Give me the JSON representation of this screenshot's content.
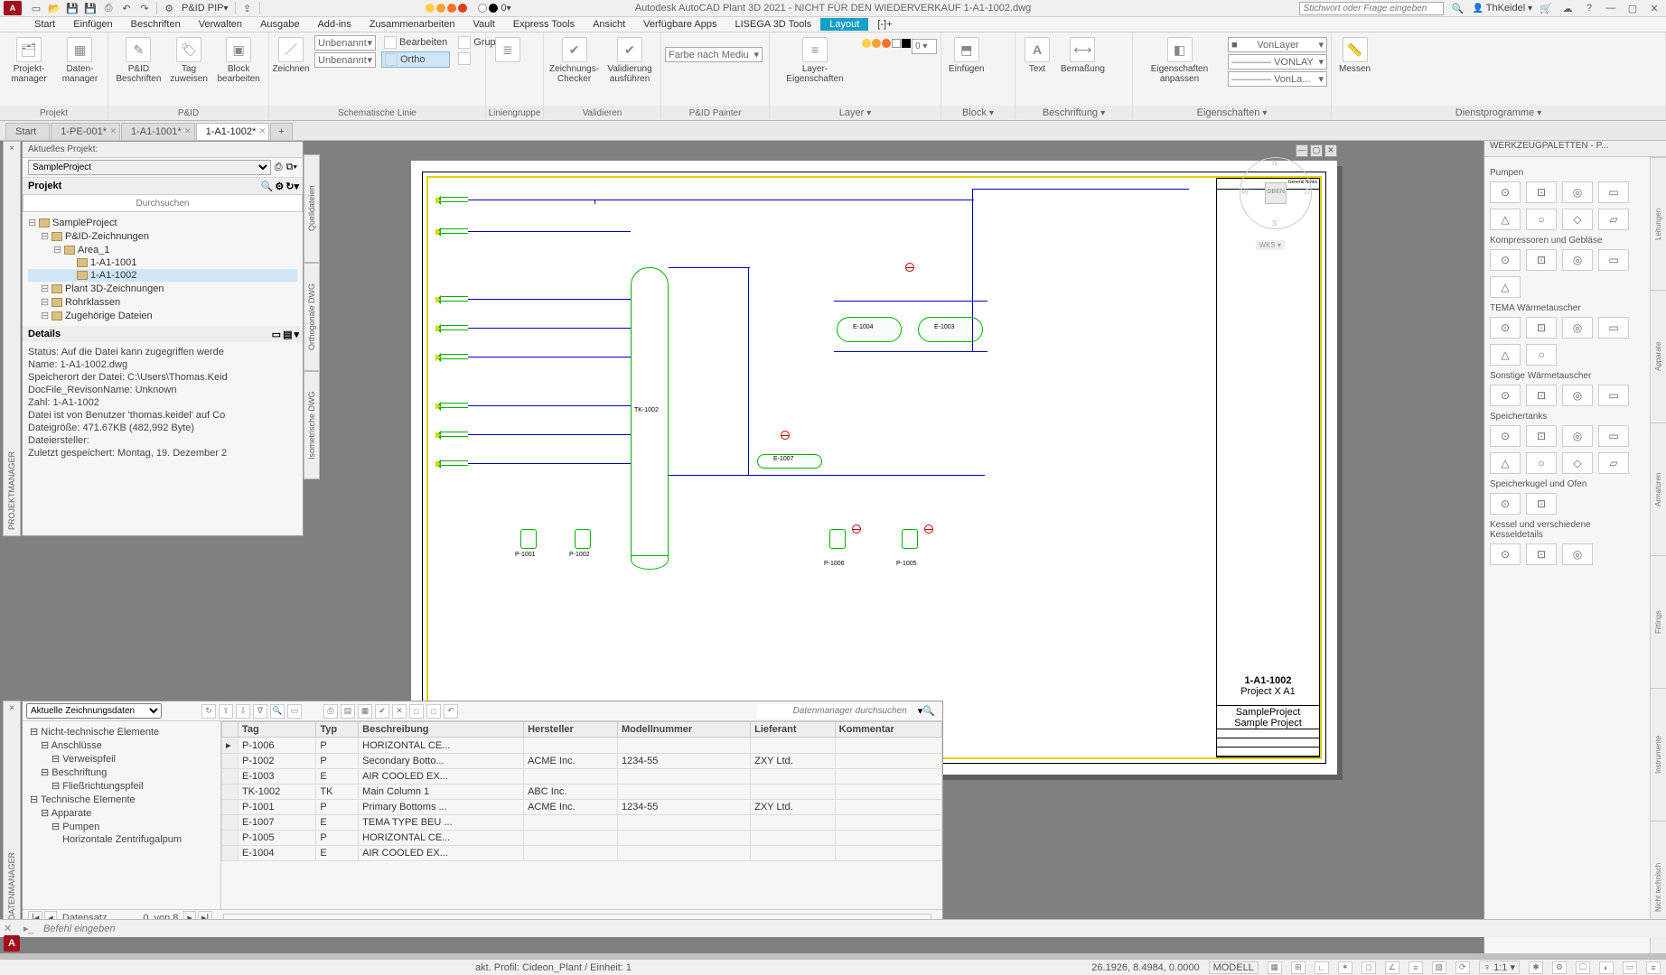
{
  "title": "Autodesk AutoCAD Plant 3D 2021 - NICHT FÜR DEN WIEDERVERKAUF    1-A1-1002.dwg",
  "workspace": "P&ID PIP",
  "gradientValue": "0",
  "searchPlaceholder": "Stichwort oder Frage eingeben",
  "user": "ThKeidel",
  "menus": [
    "Start",
    "Einfügen",
    "Beschriften",
    "Verwalten",
    "Ausgabe",
    "Add-ins",
    "Zusammenarbeiten",
    "Vault",
    "Express Tools",
    "Ansicht",
    "Verfügbare Apps",
    "LISEGA 3D Tools",
    "Layout",
    "[-]+"
  ],
  "activeMenu": "Layout",
  "ribbon": {
    "panels": [
      {
        "name": "Projekt",
        "items": [
          {
            "label": "Projekt-\nmanager"
          },
          {
            "label": "Daten-\nmanager"
          }
        ]
      },
      {
        "name": "P&ID",
        "items": [
          {
            "label": "P&ID\nBeschriften"
          },
          {
            "label": "Tag\nzuweisen"
          },
          {
            "label": "Block\nbearbeiten"
          }
        ]
      },
      {
        "name": "Schematische Linie",
        "combo1": "Unbenannt",
        "combo2": "Unbenannt",
        "miniEdit": "Bearbeiten",
        "miniGroup": "Gruppe",
        "miniOrtho": "Ortho",
        "drawBtn": "Zeichnen"
      },
      {
        "name": "Liniengruppe"
      },
      {
        "name": "Validieren",
        "items": [
          {
            "label": "Zeichnungs-\nChecker"
          },
          {
            "label": "Validierung\nausführen"
          }
        ]
      },
      {
        "name": "P&ID Painter",
        "combo": "Farbe nach Mediu"
      },
      {
        "name": "Layer",
        "label": "Layer-\nEigenschaften"
      },
      {
        "name": "Block",
        "label": "Einfügen"
      },
      {
        "name": "Beschriftung",
        "items": [
          {
            "label": "Text"
          },
          {
            "label": "Bemaßung"
          }
        ]
      },
      {
        "name": "Eigenschaften",
        "label": "Eigenschaften\nanpassen",
        "layerCombo": "VonLayer",
        "lt": "———— VONLAY",
        "lw": "———— VonLa..."
      },
      {
        "name": "Dienstprogramme",
        "label": "Messen"
      }
    ]
  },
  "docTabs": [
    {
      "label": "Start",
      "active": false,
      "closable": false
    },
    {
      "label": "1-PE-001*",
      "active": false,
      "closable": true
    },
    {
      "label": "1-A1-1001*",
      "active": false,
      "closable": true
    },
    {
      "label": "1-A1-1002*",
      "active": true,
      "closable": true
    }
  ],
  "projman": {
    "headLabel": "Aktuelles Projekt:",
    "project": "SampleProject",
    "sectionProjekt": "Projekt",
    "searchPlaceholder": "Durchsuchen",
    "tree": [
      {
        "l": "SampleProject",
        "d": 0
      },
      {
        "l": "P&ID-Zeichnungen",
        "d": 1
      },
      {
        "l": "Area_1",
        "d": 2
      },
      {
        "l": "1-A1-1001",
        "d": 3,
        "leaf": true
      },
      {
        "l": "1-A1-1002",
        "d": 3,
        "leaf": true,
        "sel": true
      },
      {
        "l": "Plant 3D-Zeichnungen",
        "d": 1
      },
      {
        "l": "Rohrklassen",
        "d": 1
      },
      {
        "l": "Zugehörige Dateien",
        "d": 1
      }
    ],
    "sectionDetails": "Details",
    "details": [
      "Status: Auf die Datei kann zugegriffen werde",
      "Name: 1-A1-1002.dwg",
      "Speicherort der Datei: C:\\Users\\Thomas.Keid",
      "DocFile_RevisonName:  Unknown",
      "Zahl: 1-A1-1002",
      "Datei ist von Benutzer 'thomas.keidel' auf Co",
      "Dateigröße: 471.67KB (482,992 Byte)",
      "Dateiersteller:",
      "Zuletzt gespeichert: Montag, 19. Dezember 2"
    ],
    "vstripLabel": "PROJEKTMANAGER"
  },
  "sideTabs": [
    "Quelldateien",
    "Orthogonale DWG",
    "Isometrische DWG"
  ],
  "viewcube": {
    "face": "OBEN",
    "n": "N",
    "s": "S",
    "w": "W",
    "o": "O",
    "wks": "WKS ▾"
  },
  "titleblock": {
    "dwgno": "1-A1-1002",
    "project": "Project   X   A1",
    "sample": "SampleProject\nSample Project"
  },
  "equipment": {
    "tank": "TK-1002",
    "ex1": "E-1004",
    "ex2": "E-1003",
    "ex3": "E-1007",
    "p1": "P-1001",
    "p2": "P-1002",
    "p3": "P-1005",
    "p4": "P-1006"
  },
  "palettes": {
    "title": "WERKZEUGPALETTEN - P...",
    "vtabs": [
      "Leitungen",
      "Apparate",
      "Armaturen",
      "Fittings",
      "Instrumente",
      "Nicht technisch"
    ],
    "groups": [
      {
        "title": "Pumpen",
        "count": 8
      },
      {
        "title": "Kompressoren und Gebläse",
        "count": 5
      },
      {
        "title": "TEMA Wärmetauscher",
        "count": 6
      },
      {
        "title": "Sonstige Wärmetauscher",
        "count": 4
      },
      {
        "title": "Speichertanks",
        "count": 8
      },
      {
        "title": "Speicherkugel und Ofen",
        "count": 2
      },
      {
        "title": "Kessel und verschiedene Kesseldetails",
        "count": 3
      }
    ]
  },
  "datamgr": {
    "vstripLabel": "DATENMANAGER",
    "viewSelect": "Aktuelle Zeichnungsdaten",
    "searchPlaceholder": "Datenmanager durchsuchen",
    "tree": [
      {
        "l": "Nicht-technische Elemente",
        "d": 0
      },
      {
        "l": "Anschlüsse",
        "d": 1
      },
      {
        "l": "Verweispfeil",
        "d": 2
      },
      {
        "l": "Beschriftung",
        "d": 1
      },
      {
        "l": "Fließrichtungspfeil",
        "d": 2
      },
      {
        "l": "Technische Elemente",
        "d": 0
      },
      {
        "l": "Apparate",
        "d": 1
      },
      {
        "l": "Pumpen",
        "d": 2
      },
      {
        "l": "Horizontale Zentrifugalpum",
        "d": 3
      }
    ],
    "cols": [
      "",
      "Tag",
      "Typ",
      "Beschreibung",
      "Hersteller",
      "Modellnummer",
      "Lieferant",
      "Kommentar"
    ],
    "rows": [
      [
        "",
        "P-1006",
        "P",
        "HORIZONTAL CE...",
        "",
        "",
        "",
        ""
      ],
      [
        "",
        "P-1002",
        "P",
        "Secondary Botto...",
        "ACME Inc.",
        "1234-55",
        "ZXY Ltd.",
        ""
      ],
      [
        "",
        "E-1003",
        "E",
        "AIR COOLED EX...",
        "",
        "",
        "",
        ""
      ],
      [
        "",
        "TK-1002",
        "TK",
        "Main Column 1",
        "ABC Inc.",
        "",
        "",
        ""
      ],
      [
        "",
        "P-1001",
        "P",
        "Primary Bottoms ...",
        "ACME Inc.",
        "1234-55",
        "ZXY Ltd.",
        ""
      ],
      [
        "",
        "E-1007",
        "E",
        "TEMA TYPE BEU ...",
        "",
        "",
        "",
        ""
      ],
      [
        "",
        "P-1005",
        "P",
        "HORIZONTAL CE...",
        "",
        "",
        "",
        ""
      ],
      [
        "",
        "E-1004",
        "E",
        "AIR COOLED EX...",
        "",
        "",
        "",
        ""
      ]
    ],
    "recLabel": "Datensatz",
    "recPos": "0",
    "recOf": "von 8"
  },
  "cmdPlaceholder": "Befehl eingeben",
  "status": {
    "profile": "akt. Profil: Cideon_Plant / Einheit: 1",
    "coords": "26.1926, 8.4984, 0.0000",
    "space": "MODELL",
    "scale": "1:1"
  }
}
